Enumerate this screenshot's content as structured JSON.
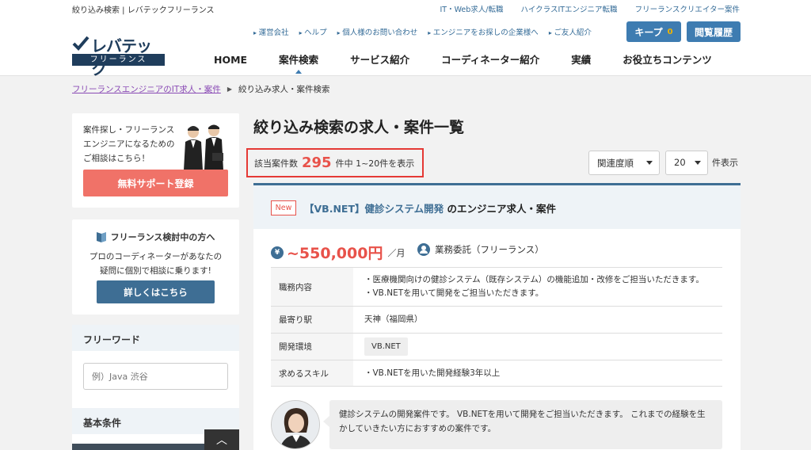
{
  "header": {
    "site_desc": "絞り込み検索 | レバテックフリーランス",
    "top_links": [
      "IT・Web求人/転職",
      "ハイクラスITエンジニア転職",
      "フリーランスクリエイター案件"
    ],
    "logo_text": "レバテック",
    "logo_sub": "フリーランス",
    "sub_links": [
      "運営会社",
      "ヘルプ",
      "個人様のお問い合わせ",
      "エンジニアをお探しの企業様へ",
      "ご友人紹介"
    ],
    "keep_label": "キープ",
    "keep_count": "0",
    "history_label": "閲覧履歴",
    "nav": [
      "HOME",
      "案件検索",
      "サービス紹介",
      "コーディネーター紹介",
      "実績",
      "お役立ちコンテンツ"
    ]
  },
  "breadcrumb": {
    "link": "フリーランスエンジニアのIT求人・案件",
    "current": "絞り込み求人・案件検索"
  },
  "sidebar": {
    "consult_lines": [
      "案件探し・フリーランス",
      "エンジニアになるための",
      "ご相談はこちら！"
    ],
    "free_button": "無料サポート登録",
    "considering_title": "フリーランス検討中の方へ",
    "considering_lines": [
      "プロのコーディネーターがあなたの",
      "疑問に個別で相談に乗ります!"
    ],
    "detail_button": "詳しくはこちら",
    "freeword_title": "フリーワード",
    "freeword_placeholder": "例）Java 渋谷",
    "basic_title": "基本条件"
  },
  "main": {
    "title": "絞り込み検索の求人・案件一覧",
    "count_prefix": "該当案件数",
    "count": "295",
    "count_suffix": "件中 1~20件を表示",
    "sort_value": "関連度順",
    "per_page_value": "20",
    "per_page_label": "件表示"
  },
  "job": {
    "badge": "New",
    "title_link": "【VB.NET】健診システム開発",
    "title_rest": " のエンジニア求人・案件",
    "salary": "~550,000円",
    "salary_unit": "／月",
    "contract": "業務委託（フリーランス）",
    "specs": [
      {
        "key": "職務内容",
        "value": "・医療機関向けの健診システム（既存システム）の機能追加・改修をご担当いただきます。 ・VB.NETを用いて開発をご担当いただきます。"
      },
      {
        "key": "最寄り駅",
        "value": "天神（福岡県）"
      },
      {
        "key": "開発環境",
        "value": "VB.NET"
      },
      {
        "key": "求めるスキル",
        "value": "・VB.NETを用いた開発経験3年以上"
      }
    ],
    "comment": "健診システムの開発案件です。 VB.NETを用いて開発をご担当いただきます。 これまでの経験を生かしていきたい方におすすめの案件です。"
  },
  "colors": {
    "accent_blue": "#3e7cb1",
    "highlight_red": "#e53935",
    "price_red": "#e8524a",
    "cta_coral": "#f07268"
  }
}
